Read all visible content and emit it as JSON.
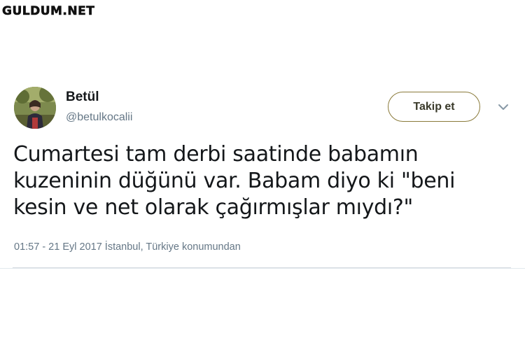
{
  "watermark": {
    "text": "GULDUM.NET"
  },
  "tweet": {
    "author": {
      "name": "Betül",
      "handle": "@betulkocalii"
    },
    "follow_label": "Takip et",
    "menu_icon": "chevron-down-icon",
    "text": "Cumartesi tam derbi saatinde babamın kuzeninin düğünü var. Babam diyo ki \"beni kesin ve net olarak çağırmışlar mıydı?\"",
    "timestamp": "01:57 - 21 Eyl 2017",
    "location": "İstanbul, Türkiye konumundan"
  },
  "colors": {
    "text_primary": "#14171a",
    "text_secondary": "#657786",
    "follow_border": "#8a7a3a"
  }
}
